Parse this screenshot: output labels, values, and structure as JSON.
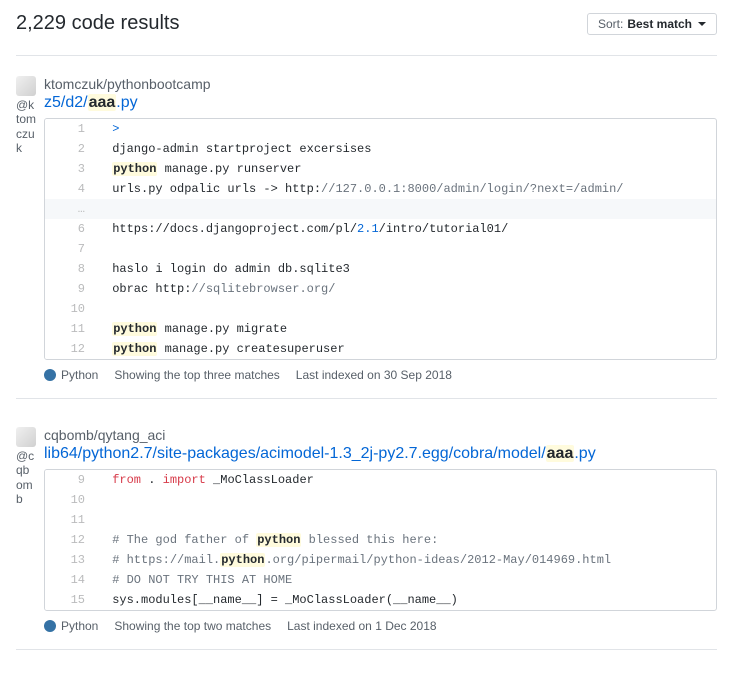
{
  "header": {
    "title": "2,229 code results",
    "sort_prefix": "Sort:",
    "sort_value": "Best match"
  },
  "results": [
    {
      "avatar_user": "@ktomczuk",
      "repo": "ktomczuk/pythonbootcamp",
      "path_prefix": "z5/d2/",
      "path_hl": "aaa",
      "path_suffix": ".py",
      "rows": [
        {
          "num": "1",
          "html": " <span class=\"c-blue\">></span>"
        },
        {
          "num": "2",
          "html": " django-admin startproject excersises"
        },
        {
          "num": "3",
          "html": " <span class=\"hl\">python</span> manage.py runserver"
        },
        {
          "num": "4",
          "html": " urls.py odpalic urls -> http:<span class=\"c-gray\">//127.0.0.1:8000/admin/login/?next=/admin/</span>"
        },
        {
          "divider": true,
          "num": "…",
          "html": ""
        },
        {
          "num": "6",
          "html": " https://docs.djangoproject.com/pl/<span class=\"c-blue\">2.1</span>/intro/tutorial01/"
        },
        {
          "num": "7",
          "html": ""
        },
        {
          "num": "8",
          "html": " haslo i login do admin db.sqlite3"
        },
        {
          "num": "9",
          "html": " obrac http:<span class=\"c-gray\">//sqlitebrowser.org/</span>"
        },
        {
          "num": "10",
          "html": ""
        },
        {
          "num": "11",
          "html": " <span class=\"hl\">python</span> manage.py migrate"
        },
        {
          "num": "12",
          "html": " <span class=\"hl\">python</span> manage.py createsuperuser"
        }
      ],
      "lang": "Python",
      "matches": "Showing the top three matches",
      "indexed": "Last indexed on 30 Sep 2018"
    },
    {
      "avatar_user": "@cqbomb",
      "repo": "cqbomb/qytang_aci",
      "path_prefix": "lib64/python2.7/site-packages/acimodel-1.3_2j-py2.7.egg/cobra/model/",
      "path_hl": "aaa",
      "path_suffix": ".py",
      "rows": [
        {
          "num": "9",
          "html": " <span class=\"c-red\">from</span> . <span class=\"c-red\">import</span> _MoClassLoader"
        },
        {
          "num": "10",
          "html": ""
        },
        {
          "num": "11",
          "html": ""
        },
        {
          "num": "12",
          "html": " <span class=\"c-gray\"># The god father of <span class=\"hl\">python</span> blessed this here:</span>"
        },
        {
          "num": "13",
          "html": " <span class=\"c-gray\"># https://mail.<span class=\"hl\">python</span>.org/pipermail/python-ideas/2012-May/014969.html</span>"
        },
        {
          "num": "14",
          "html": " <span class=\"c-gray\"># DO NOT TRY THIS AT HOME</span>"
        },
        {
          "num": "15",
          "html": " sys.modules[__name__] = _MoClassLoader(__name__)"
        }
      ],
      "lang": "Python",
      "matches": "Showing the top two matches",
      "indexed": "Last indexed on 1 Dec 2018"
    }
  ]
}
